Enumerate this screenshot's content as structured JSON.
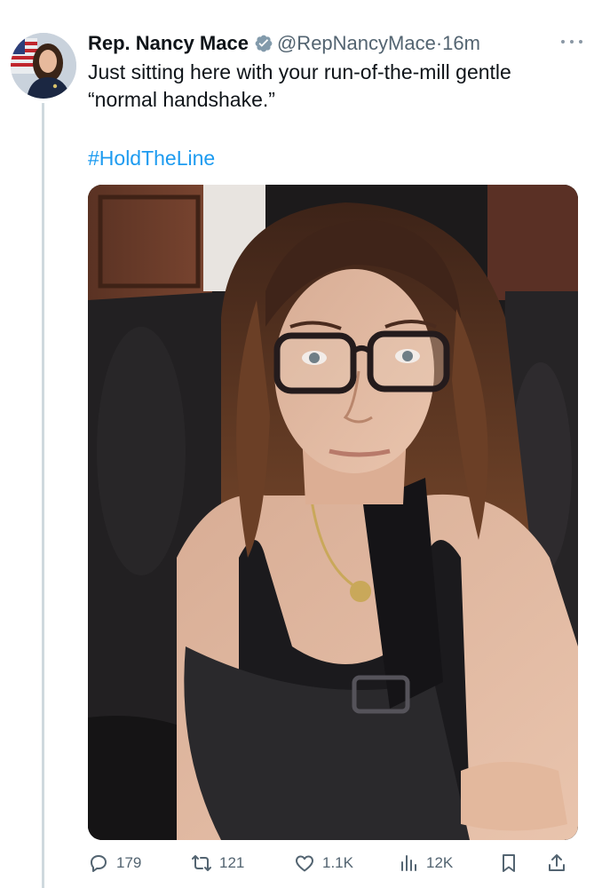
{
  "tweet": {
    "display_name": "Rep. Nancy Mace",
    "handle": "@RepNancyMace",
    "separator": "·",
    "time": "16m",
    "text": "Just sitting here with your run-of-the-mill gentle “normal handshake.”",
    "hashtag": "#HoldTheLine",
    "verified_icon": "verified-badge-icon",
    "verified_color": "#829aab",
    "link_color": "#1d9bf0"
  },
  "actions": {
    "replies": "179",
    "reposts": "121",
    "likes": "1.1K",
    "views": "12K"
  },
  "icons": {
    "reply": "reply-icon",
    "repost": "repost-icon",
    "like": "heart-icon",
    "views": "bar-chart-icon",
    "bookmark": "bookmark-icon",
    "share": "share-icon",
    "more": "more-dots-icon"
  }
}
